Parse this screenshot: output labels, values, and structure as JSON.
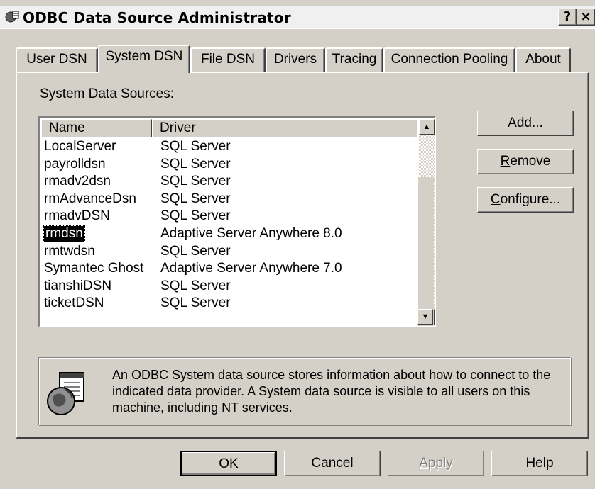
{
  "window": {
    "title": "ODBC Data Source Administrator",
    "help_button": "?",
    "close_button": "×"
  },
  "tabs": [
    {
      "label": "User DSN"
    },
    {
      "label": "System DSN"
    },
    {
      "label": "File DSN"
    },
    {
      "label": "Drivers"
    },
    {
      "label": "Tracing"
    },
    {
      "label": "Connection Pooling"
    },
    {
      "label": "About"
    }
  ],
  "active_tab": "System DSN",
  "system_sources": {
    "label_prefix": "S",
    "label_rest": "ystem Data Sources:",
    "columns": [
      "Name",
      "Driver"
    ],
    "rows": [
      {
        "name": "LocalServer",
        "driver": "SQL Server"
      },
      {
        "name": "payrolldsn",
        "driver": "SQL Server"
      },
      {
        "name": "rmadv2dsn",
        "driver": "SQL Server"
      },
      {
        "name": "rmAdvanceDsn",
        "driver": "SQL Server"
      },
      {
        "name": "rmadvDSN",
        "driver": "SQL Server"
      },
      {
        "name": "rmdsn",
        "driver": "Adaptive Server Anywhere 8.0"
      },
      {
        "name": "rmtwdsn",
        "driver": "SQL Server"
      },
      {
        "name": "Symantec Ghost",
        "driver": "Adaptive Server Anywhere 7.0"
      },
      {
        "name": "tianshiDSN",
        "driver": "SQL Server"
      },
      {
        "name": "ticketDSN",
        "driver": "SQL Server"
      }
    ],
    "selected": "rmdsn"
  },
  "side_buttons": {
    "add_pre": "A",
    "add_key": "d",
    "add_post": "d...",
    "remove_key": "R",
    "remove_post": "emove",
    "configure_key": "C",
    "configure_post": "onfigure..."
  },
  "info_text": "An ODBC System data source stores information about how to connect to the indicated data provider.   A System data source is visible to all users on this machine, including NT services.",
  "footer_buttons": {
    "ok": "OK",
    "cancel": "Cancel",
    "apply_key": "A",
    "apply_post": "pply",
    "help": "Help"
  }
}
